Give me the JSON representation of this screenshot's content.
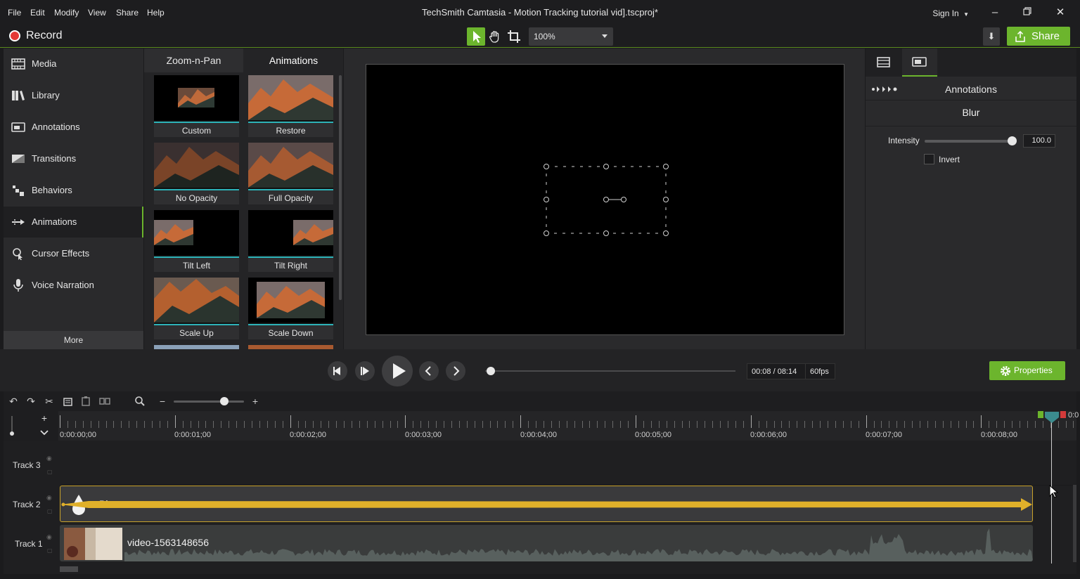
{
  "menu": [
    "File",
    "Edit",
    "Modify",
    "View",
    "Share",
    "Help"
  ],
  "window_title": "TechSmith Camtasia - Motion Tracking tutorial vid].tscproj*",
  "sign_in": "Sign In",
  "toolbar": {
    "record_label": "Record",
    "zoom_value": "100%",
    "share_label": "Share"
  },
  "sidebar": {
    "items": [
      {
        "label": "Media",
        "icon": "film-icon"
      },
      {
        "label": "Library",
        "icon": "books-icon"
      },
      {
        "label": "Annotations",
        "icon": "annotation-icon"
      },
      {
        "label": "Transitions",
        "icon": "transition-icon"
      },
      {
        "label": "Behaviors",
        "icon": "behavior-icon"
      },
      {
        "label": "Animations",
        "icon": "animation-icon"
      },
      {
        "label": "Cursor Effects",
        "icon": "cursor-effects-icon"
      },
      {
        "label": "Voice Narration",
        "icon": "microphone-icon"
      }
    ],
    "active": "Animations",
    "more_label": "More"
  },
  "panel": {
    "tabs": [
      "Zoom-n-Pan",
      "Animations"
    ],
    "active_tab": "Animations",
    "thumbnails": [
      "Custom",
      "Restore",
      "No Opacity",
      "Full Opacity",
      "Tilt Left",
      "Tilt Right",
      "Scale Up",
      "Scale Down"
    ]
  },
  "properties": {
    "header": "Annotations",
    "subheader": "Blur",
    "intensity_label": "Intensity",
    "intensity_value": "100.0",
    "intensity_fraction": 1.0,
    "invert_label": "Invert"
  },
  "playback": {
    "time": "00:08 / 08:14",
    "fps": "60fps",
    "properties_label": "Properties"
  },
  "timeline": {
    "ruler_ticks": [
      "0:00:00;00",
      "0:00:01;00",
      "0:00:02;00",
      "0:00:03;00",
      "0:00:04;00",
      "0:00:05;00",
      "0:00:06;00",
      "0:00:07;00",
      "0:00:08;00"
    ],
    "ruler_end_partial": "0:0",
    "tracks": [
      "Track 3",
      "Track 2",
      "Track 1"
    ],
    "blur_clip_label": "Blur",
    "video_clip_label": "video-1563148656"
  },
  "colors": {
    "accent_green": "#6cb52d",
    "clip_gold": "#e0b02a",
    "record_red": "#e53935",
    "thumb_underline": "#2db3b8"
  }
}
